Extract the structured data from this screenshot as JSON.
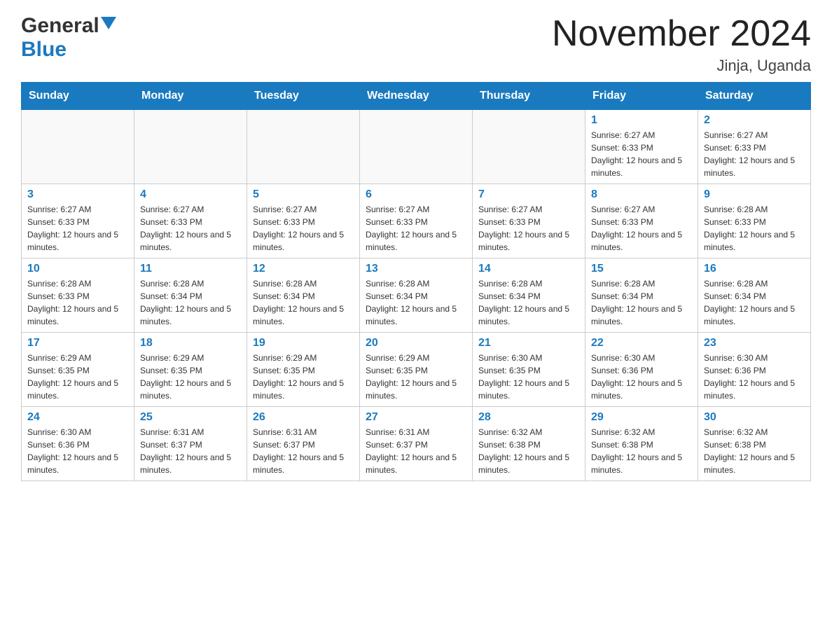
{
  "header": {
    "logo_general": "General",
    "logo_blue": "Blue",
    "month_title": "November 2024",
    "location": "Jinja, Uganda"
  },
  "calendar": {
    "days_of_week": [
      "Sunday",
      "Monday",
      "Tuesday",
      "Wednesday",
      "Thursday",
      "Friday",
      "Saturday"
    ],
    "weeks": [
      [
        {
          "day": "",
          "info": ""
        },
        {
          "day": "",
          "info": ""
        },
        {
          "day": "",
          "info": ""
        },
        {
          "day": "",
          "info": ""
        },
        {
          "day": "",
          "info": ""
        },
        {
          "day": "1",
          "info": "Sunrise: 6:27 AM\nSunset: 6:33 PM\nDaylight: 12 hours and 5 minutes."
        },
        {
          "day": "2",
          "info": "Sunrise: 6:27 AM\nSunset: 6:33 PM\nDaylight: 12 hours and 5 minutes."
        }
      ],
      [
        {
          "day": "3",
          "info": "Sunrise: 6:27 AM\nSunset: 6:33 PM\nDaylight: 12 hours and 5 minutes."
        },
        {
          "day": "4",
          "info": "Sunrise: 6:27 AM\nSunset: 6:33 PM\nDaylight: 12 hours and 5 minutes."
        },
        {
          "day": "5",
          "info": "Sunrise: 6:27 AM\nSunset: 6:33 PM\nDaylight: 12 hours and 5 minutes."
        },
        {
          "day": "6",
          "info": "Sunrise: 6:27 AM\nSunset: 6:33 PM\nDaylight: 12 hours and 5 minutes."
        },
        {
          "day": "7",
          "info": "Sunrise: 6:27 AM\nSunset: 6:33 PM\nDaylight: 12 hours and 5 minutes."
        },
        {
          "day": "8",
          "info": "Sunrise: 6:27 AM\nSunset: 6:33 PM\nDaylight: 12 hours and 5 minutes."
        },
        {
          "day": "9",
          "info": "Sunrise: 6:28 AM\nSunset: 6:33 PM\nDaylight: 12 hours and 5 minutes."
        }
      ],
      [
        {
          "day": "10",
          "info": "Sunrise: 6:28 AM\nSunset: 6:33 PM\nDaylight: 12 hours and 5 minutes."
        },
        {
          "day": "11",
          "info": "Sunrise: 6:28 AM\nSunset: 6:34 PM\nDaylight: 12 hours and 5 minutes."
        },
        {
          "day": "12",
          "info": "Sunrise: 6:28 AM\nSunset: 6:34 PM\nDaylight: 12 hours and 5 minutes."
        },
        {
          "day": "13",
          "info": "Sunrise: 6:28 AM\nSunset: 6:34 PM\nDaylight: 12 hours and 5 minutes."
        },
        {
          "day": "14",
          "info": "Sunrise: 6:28 AM\nSunset: 6:34 PM\nDaylight: 12 hours and 5 minutes."
        },
        {
          "day": "15",
          "info": "Sunrise: 6:28 AM\nSunset: 6:34 PM\nDaylight: 12 hours and 5 minutes."
        },
        {
          "day": "16",
          "info": "Sunrise: 6:28 AM\nSunset: 6:34 PM\nDaylight: 12 hours and 5 minutes."
        }
      ],
      [
        {
          "day": "17",
          "info": "Sunrise: 6:29 AM\nSunset: 6:35 PM\nDaylight: 12 hours and 5 minutes."
        },
        {
          "day": "18",
          "info": "Sunrise: 6:29 AM\nSunset: 6:35 PM\nDaylight: 12 hours and 5 minutes."
        },
        {
          "day": "19",
          "info": "Sunrise: 6:29 AM\nSunset: 6:35 PM\nDaylight: 12 hours and 5 minutes."
        },
        {
          "day": "20",
          "info": "Sunrise: 6:29 AM\nSunset: 6:35 PM\nDaylight: 12 hours and 5 minutes."
        },
        {
          "day": "21",
          "info": "Sunrise: 6:30 AM\nSunset: 6:35 PM\nDaylight: 12 hours and 5 minutes."
        },
        {
          "day": "22",
          "info": "Sunrise: 6:30 AM\nSunset: 6:36 PM\nDaylight: 12 hours and 5 minutes."
        },
        {
          "day": "23",
          "info": "Sunrise: 6:30 AM\nSunset: 6:36 PM\nDaylight: 12 hours and 5 minutes."
        }
      ],
      [
        {
          "day": "24",
          "info": "Sunrise: 6:30 AM\nSunset: 6:36 PM\nDaylight: 12 hours and 5 minutes."
        },
        {
          "day": "25",
          "info": "Sunrise: 6:31 AM\nSunset: 6:37 PM\nDaylight: 12 hours and 5 minutes."
        },
        {
          "day": "26",
          "info": "Sunrise: 6:31 AM\nSunset: 6:37 PM\nDaylight: 12 hours and 5 minutes."
        },
        {
          "day": "27",
          "info": "Sunrise: 6:31 AM\nSunset: 6:37 PM\nDaylight: 12 hours and 5 minutes."
        },
        {
          "day": "28",
          "info": "Sunrise: 6:32 AM\nSunset: 6:38 PM\nDaylight: 12 hours and 5 minutes."
        },
        {
          "day": "29",
          "info": "Sunrise: 6:32 AM\nSunset: 6:38 PM\nDaylight: 12 hours and 5 minutes."
        },
        {
          "day": "30",
          "info": "Sunrise: 6:32 AM\nSunset: 6:38 PM\nDaylight: 12 hours and 5 minutes."
        }
      ]
    ]
  }
}
